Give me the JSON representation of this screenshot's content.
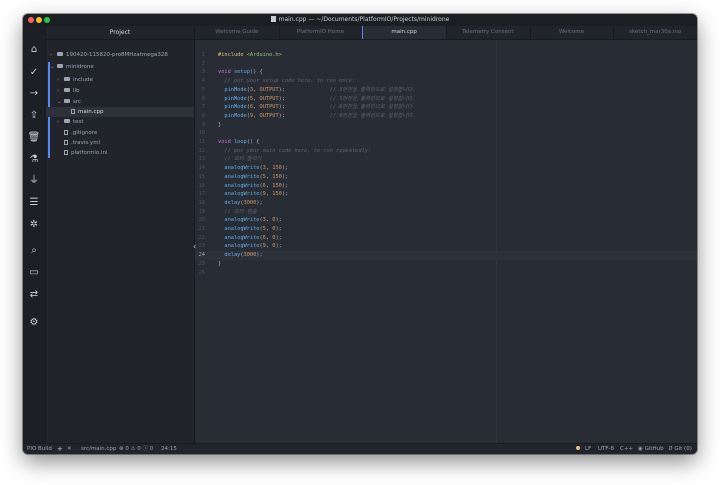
{
  "window": {
    "title": "main.cpp — ~/Documents/PlatformIO/Projects/minidrone"
  },
  "rail": {
    "items": [
      {
        "name": "pio-home-icon",
        "glyph": "⌂"
      },
      {
        "name": "check-icon",
        "glyph": "✓"
      },
      {
        "name": "arrow-right-icon",
        "glyph": "→"
      },
      {
        "name": "upload-cloud-icon",
        "glyph": "⇪"
      },
      {
        "name": "trash-icon",
        "glyph": "🗑"
      },
      {
        "name": "flask-icon",
        "glyph": "⚗"
      },
      {
        "name": "plug-icon",
        "glyph": "⏚"
      },
      {
        "name": "task-list-icon",
        "glyph": "☰"
      },
      {
        "name": "bug-icon",
        "glyph": "✲"
      },
      {
        "name": "search-icon",
        "glyph": "⌕"
      },
      {
        "name": "terminal-icon",
        "glyph": "▭"
      },
      {
        "name": "plug-socket-icon",
        "glyph": "⇄"
      },
      {
        "name": "gear-icon",
        "glyph": "⚙"
      }
    ]
  },
  "tree": {
    "header": "Project",
    "items": [
      {
        "label": "190420-115820-pro8MHzatmega328",
        "level": 0,
        "chev": "›",
        "type": "folder"
      },
      {
        "label": "minidrone",
        "level": 0,
        "chev": "⌄",
        "type": "folder"
      },
      {
        "label": "include",
        "level": 1,
        "chev": "›",
        "type": "folder"
      },
      {
        "label": "lib",
        "level": 1,
        "chev": "›",
        "type": "folder"
      },
      {
        "label": "src",
        "level": 1,
        "chev": "⌄",
        "type": "folder"
      },
      {
        "label": "main.cpp",
        "level": 2,
        "chev": "",
        "type": "file",
        "selected": true
      },
      {
        "label": "test",
        "level": 1,
        "chev": "›",
        "type": "folder"
      },
      {
        "label": ".gitignore",
        "level": 1,
        "chev": "",
        "type": "file"
      },
      {
        "label": ".travis.yml",
        "level": 1,
        "chev": "",
        "type": "file"
      },
      {
        "label": "platformio.ini",
        "level": 1,
        "chev": "",
        "type": "file"
      }
    ]
  },
  "tabs": [
    {
      "label": "Welcome Guide",
      "active": false
    },
    {
      "label": "PlatformIO Home",
      "active": false
    },
    {
      "label": "main.cpp",
      "active": true
    },
    {
      "label": "Telemetry Consent",
      "active": false
    },
    {
      "label": "Welcome",
      "active": false
    },
    {
      "label": "sketch_mar30a.ino",
      "active": false
    }
  ],
  "editor": {
    "current_line": 24,
    "lines": [
      [
        [
          "d",
          "#include "
        ],
        [
          "s",
          "<Arduino.h>"
        ]
      ],
      [],
      [
        [
          "k",
          "void "
        ],
        [
          "f",
          "setup"
        ],
        [
          "p",
          "() {"
        ]
      ],
      [
        [
          "c",
          "  // put your setup code here, to run once:"
        ]
      ],
      [
        [
          "f",
          "  pinMode"
        ],
        [
          "p",
          "("
        ],
        [
          "n",
          "3"
        ],
        [
          "p",
          ", "
        ],
        [
          "n",
          "OUTPUT"
        ],
        [
          "p",
          ");"
        ],
        [
          "c",
          "              // 3번핀을 출력핀으로 설정합니다."
        ]
      ],
      [
        [
          "f",
          "  pinMode"
        ],
        [
          "p",
          "("
        ],
        [
          "n",
          "5"
        ],
        [
          "p",
          ", "
        ],
        [
          "n",
          "OUTPUT"
        ],
        [
          "p",
          ");"
        ],
        [
          "c",
          "              // 5번핀을 출력핀으로 설정합니다."
        ]
      ],
      [
        [
          "f",
          "  pinMode"
        ],
        [
          "p",
          "("
        ],
        [
          "n",
          "6"
        ],
        [
          "p",
          ", "
        ],
        [
          "n",
          "OUTPUT"
        ],
        [
          "p",
          ");"
        ],
        [
          "c",
          "              // 6번핀을 출력핀으로 설정합니다."
        ]
      ],
      [
        [
          "f",
          "  pinMode"
        ],
        [
          "p",
          "("
        ],
        [
          "n",
          "9"
        ],
        [
          "p",
          ", "
        ],
        [
          "n",
          "OUTPUT"
        ],
        [
          "p",
          ");"
        ],
        [
          "c",
          "              // 9번핀을 출력핀으로 설정합니다."
        ]
      ],
      [
        [
          "p",
          "}"
        ]
      ],
      [],
      [
        [
          "k",
          "void "
        ],
        [
          "f",
          "loop"
        ],
        [
          "p",
          "() {"
        ]
      ],
      [
        [
          "c",
          "  // put your main code here, to run repeatedly:"
        ]
      ],
      [
        [
          "c",
          "  // 모터 돌리기"
        ]
      ],
      [
        [
          "f",
          "  analogWrite"
        ],
        [
          "p",
          "("
        ],
        [
          "n",
          "3"
        ],
        [
          "p",
          ", "
        ],
        [
          "n",
          "150"
        ],
        [
          "p",
          ");"
        ]
      ],
      [
        [
          "f",
          "  analogWrite"
        ],
        [
          "p",
          "("
        ],
        [
          "n",
          "5"
        ],
        [
          "p",
          ", "
        ],
        [
          "n",
          "150"
        ],
        [
          "p",
          ");"
        ]
      ],
      [
        [
          "f",
          "  analogWrite"
        ],
        [
          "p",
          "("
        ],
        [
          "n",
          "6"
        ],
        [
          "p",
          ", "
        ],
        [
          "n",
          "150"
        ],
        [
          "p",
          ");"
        ]
      ],
      [
        [
          "f",
          "  analogWrite"
        ],
        [
          "p",
          "("
        ],
        [
          "n",
          "9"
        ],
        [
          "p",
          ", "
        ],
        [
          "n",
          "150"
        ],
        [
          "p",
          ");"
        ]
      ],
      [
        [
          "f",
          "  delay"
        ],
        [
          "p",
          "("
        ],
        [
          "n",
          "3000"
        ],
        [
          "p",
          ");"
        ]
      ],
      [
        [
          "c",
          "  // 모터 멈춤"
        ]
      ],
      [
        [
          "f",
          "  analogWrite"
        ],
        [
          "p",
          "("
        ],
        [
          "n",
          "3"
        ],
        [
          "p",
          ", "
        ],
        [
          "n",
          "0"
        ],
        [
          "p",
          ");"
        ]
      ],
      [
        [
          "f",
          "  analogWrite"
        ],
        [
          "p",
          "("
        ],
        [
          "n",
          "5"
        ],
        [
          "p",
          ", "
        ],
        [
          "n",
          "0"
        ],
        [
          "p",
          ");"
        ]
      ],
      [
        [
          "f",
          "  analogWrite"
        ],
        [
          "p",
          "("
        ],
        [
          "n",
          "6"
        ],
        [
          "p",
          ", "
        ],
        [
          "n",
          "0"
        ],
        [
          "p",
          ");"
        ]
      ],
      [
        [
          "f",
          "  analogWrite"
        ],
        [
          "p",
          "("
        ],
        [
          "n",
          "9"
        ],
        [
          "p",
          ", "
        ],
        [
          "n",
          "0"
        ],
        [
          "p",
          ");"
        ]
      ],
      [
        [
          "f",
          "  delay"
        ],
        [
          "p",
          "("
        ],
        [
          "n",
          "3000"
        ],
        [
          "p",
          ");"
        ]
      ],
      [
        [
          "p",
          "}"
        ]
      ],
      []
    ]
  },
  "status": {
    "build": "PIO Build",
    "add": "+",
    "close": "✕",
    "file": "src/main.cpp",
    "problems": "⊗ 0 ⚠ 0 ⓘ 0",
    "cursor": "24:15",
    "line_ending": "LF",
    "encoding": "UTF-8",
    "grammar": "C++",
    "github": "GitHub",
    "git": "Git (0)"
  }
}
